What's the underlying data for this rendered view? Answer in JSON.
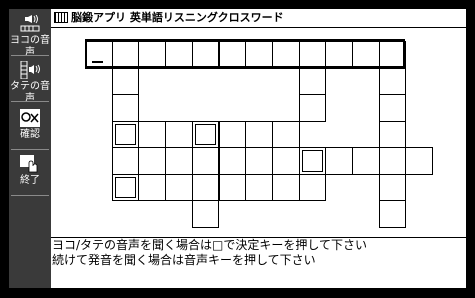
{
  "sidebar": {
    "items": [
      {
        "label": "ヨコの音声",
        "icon": "speaker-horizontal-icon"
      },
      {
        "label": "タテの音声",
        "icon": "speaker-vertical-icon"
      },
      {
        "label": "確認",
        "icon": "check-mark-icon"
      },
      {
        "label": "終了",
        "icon": "hand-stop-icon"
      }
    ]
  },
  "header": {
    "title": "脳鍛アプリ 英単語リスニングクロスワード"
  },
  "footer": {
    "line1": "ヨコ/タテの音声を聞く場合は□で決定キーを押して下さい",
    "line2": "続けて発音を聞く場合は音声キーを押して下さい"
  },
  "colors": {
    "frame": "#000000",
    "sidebar": "#3a3a3a",
    "panel": "#ffffff"
  }
}
